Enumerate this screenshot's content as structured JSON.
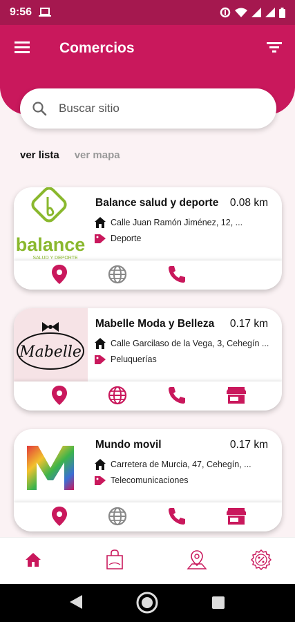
{
  "status_bar": {
    "time": "9:56"
  },
  "header": {
    "title": "Comercios"
  },
  "search": {
    "placeholder": "Buscar sitio"
  },
  "view_tabs": {
    "list_label": "ver lista",
    "map_label": "ver mapa"
  },
  "colors": {
    "brand": "#c9185c",
    "brand_dark": "#a5184f",
    "icon_accent": "#c9185c",
    "icon_muted": "#888888",
    "background": "#fbf2f4"
  },
  "businesses": [
    {
      "name": "Balance salud y deporte",
      "distance": "0.08 km",
      "address": "Calle Juan Ramón Jiménez, 12, ...",
      "category": "Deporte",
      "logo_text": "balance",
      "logo_subtext": "SALUD Y DEPORTE",
      "actions": [
        "location-icon",
        "web-icon-disabled",
        "phone-icon"
      ]
    },
    {
      "name": "Mabelle Moda y Belleza",
      "distance": "0.17 km",
      "address": "Calle Garcilaso de la Vega, 3, Cehegín ...",
      "category": "Peluquerías",
      "logo_text": "Mabelle",
      "actions": [
        "location-icon",
        "web-icon",
        "phone-icon",
        "store-icon"
      ]
    },
    {
      "name": "Mundo movil",
      "distance": "0.17 km",
      "address": "Carretera de Murcia, 47, Cehegín, ...",
      "category": "Telecomunicaciones",
      "logo_text": "M",
      "actions": [
        "location-icon",
        "web-icon-disabled",
        "phone-icon",
        "store-icon"
      ]
    }
  ],
  "bottom_nav": [
    "home-icon",
    "shopping-bag-icon",
    "map-pin-icon",
    "discount-icon"
  ]
}
